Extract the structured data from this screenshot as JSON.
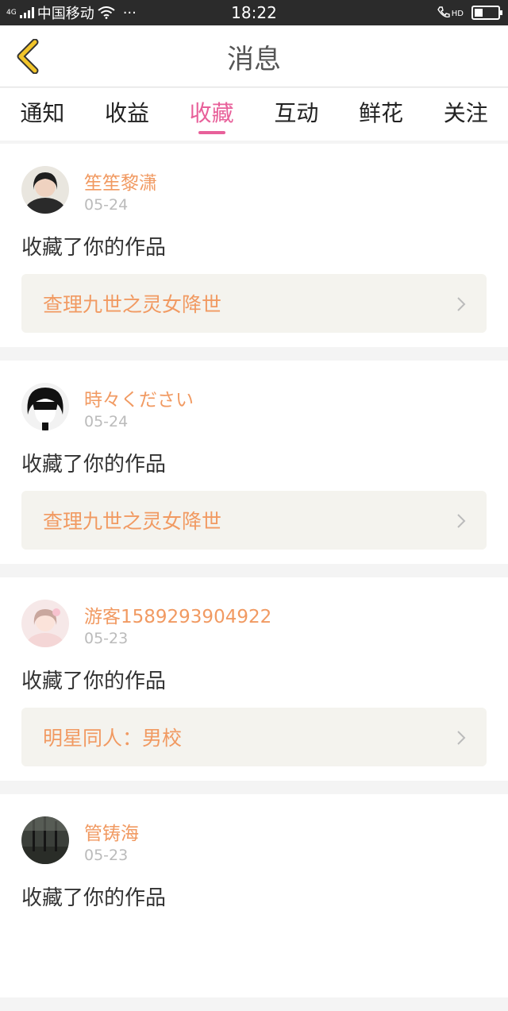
{
  "status_bar": {
    "network_tag": "4G",
    "carrier": "中国移动",
    "more": "···",
    "time": "18:22",
    "call_tag": "HD"
  },
  "header": {
    "title": "消息"
  },
  "tabs": [
    {
      "label": "通知",
      "active": false
    },
    {
      "label": "收益",
      "active": false
    },
    {
      "label": "收藏",
      "active": true
    },
    {
      "label": "互动",
      "active": false
    },
    {
      "label": "鲜花",
      "active": false
    },
    {
      "label": "关注",
      "active": false
    }
  ],
  "colors": {
    "accent_pink": "#e8609a",
    "name_orange": "#f19a62",
    "back_yellow": "#f2c52a"
  },
  "messages": [
    {
      "user": "笙笙黎潇",
      "date": "05-24",
      "action": "收藏了你的作品",
      "work": "查理九世之灵女降世"
    },
    {
      "user": "時々ください",
      "date": "05-24",
      "action": "收藏了你的作品",
      "work": "查理九世之灵女降世"
    },
    {
      "user": "游客1589293904922",
      "date": "05-23",
      "action": "收藏了你的作品",
      "work": "明星同人：男校"
    },
    {
      "user": "管铸海",
      "date": "05-23",
      "action": "收藏了你的作品",
      "work": ""
    }
  ]
}
